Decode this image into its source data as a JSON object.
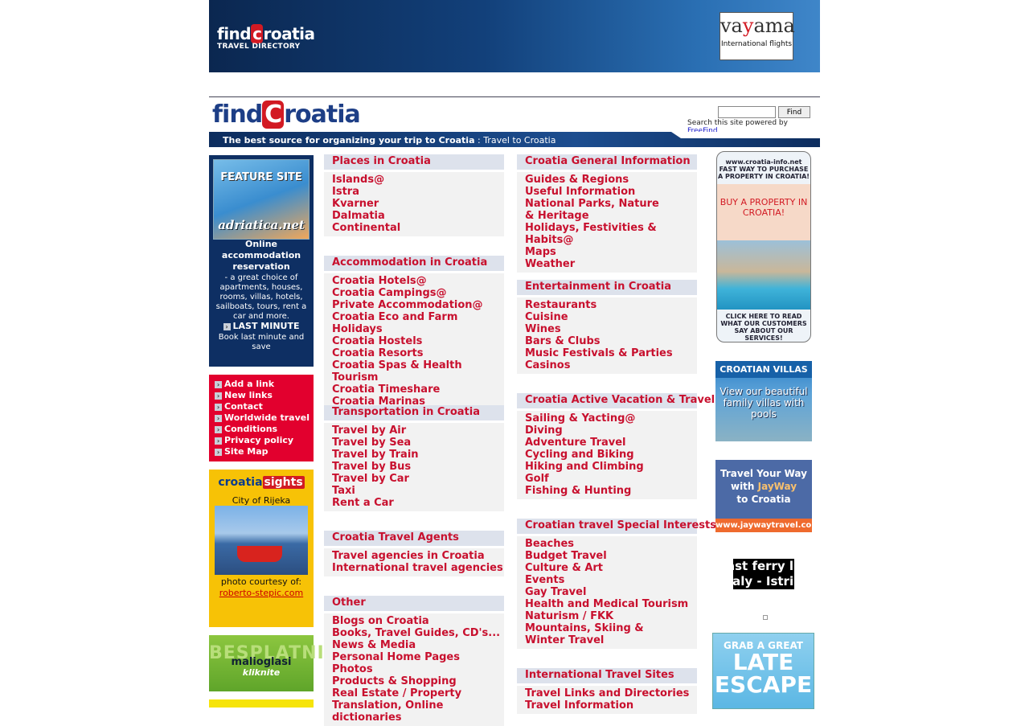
{
  "banner": {
    "logo_line1": "findcroatia",
    "logo_line2": "TRAVEL DIRECTORY",
    "ad_vayama": {
      "name": "vayama",
      "tagline": "International flights"
    }
  },
  "header": {
    "logo": "findcroatia",
    "search": {
      "placeholder": "",
      "button": "Find",
      "powered_text": "Search this site powered by",
      "powered_link": "FreeFind"
    },
    "tagline_bold": "The best source for organizing your trip to Croatia",
    "tagline_rest": " : Travel to Croatia"
  },
  "sidebar": {
    "feature": {
      "badge": "FEATURE SITE",
      "site": "adriatica.net",
      "title": "Online accommodation reservation",
      "desc": "- a great choice of apartments, houses, rooms, villas, hotels, sailboats, tours, rent a car and more.",
      "last_minute": "LAST MINUTE",
      "last_minute_desc": "Book last minute and save"
    },
    "links": [
      "Add a link",
      "New links",
      "Contact",
      "Worldwide travel",
      "Conditions",
      "Privacy policy",
      "Site Map"
    ],
    "sights": {
      "logo_a": "croatia",
      "logo_b": "sights",
      "city": "City of Rijeka",
      "caption": "photo courtesy of:",
      "credit": "roberto-stepic.com"
    },
    "oglasi": {
      "big": "BESPLATNI",
      "name": "malioglasi",
      "cta": "kliknite"
    }
  },
  "columns": {
    "left": [
      {
        "title": "Places in Croatia",
        "links": [
          "Islands@",
          "Istra",
          "Kvarner",
          "Dalmatia",
          "Continental"
        ]
      },
      {
        "title": "Accommodation in Croatia",
        "links": [
          "Croatia Hotels@",
          "Croatia Campings@",
          "Private Accommodation@",
          "Croatia Eco and Farm Holidays",
          "Croatia Hostels",
          "Croatia Resorts",
          "Croatia Spas & Health Tourism",
          "Croatia Timeshare",
          "Croatia Marinas"
        ]
      },
      {
        "title": "Transportation in Croatia",
        "links": [
          "Travel by Air",
          "Travel by Sea",
          "Travel by Train",
          "Travel by Bus",
          "Travel by Car",
          "Taxi",
          "Rent a Car"
        ]
      },
      {
        "title": "Croatia Travel Agents",
        "links": [
          "Travel agencies in Croatia",
          "International travel agencies"
        ]
      },
      {
        "title": "Other",
        "links": [
          "Blogs on Croatia",
          "Books, Travel Guides, CD's...",
          "News & Media",
          "Personal Home Pages",
          "Photos",
          "Products & Shopping",
          "Real Estate / Property",
          "Translation, Online dictionaries"
        ]
      }
    ],
    "right": [
      {
        "title": "Croatia General Information",
        "links": [
          "Guides & Regions",
          "Useful Information",
          "National Parks, Nature & Heritage",
          "Holidays, Festivities & Habits@",
          "Maps",
          "Weather"
        ]
      },
      {
        "title": "Entertainment in Croatia",
        "links": [
          "Restaurants",
          "Cuisine",
          "Wines",
          "Bars & Clubs",
          "Music Festivals & Parties",
          "Casinos"
        ]
      },
      {
        "title": "Croatia Active Vacation & Travel",
        "links": [
          "Sailing & Yacting@",
          "Diving",
          "Adventure Travel",
          "Cycling and Biking",
          "Hiking and Climbing",
          "Golf",
          "Fishing & Hunting"
        ]
      },
      {
        "title": "Croatian travel Special Interests",
        "links": [
          "Beaches",
          "Budget Travel",
          "Culture & Art",
          "Events",
          "Gay Travel",
          "Health and Medical Tourism",
          "Naturism / FKK",
          "Mountains, Skiing & Winter Travel"
        ]
      },
      {
        "title": "International Travel Sites",
        "links": [
          "Travel Links and Directories",
          "Travel Information"
        ]
      }
    ]
  },
  "ads": {
    "croatia_info": {
      "top": "www.croatia-info.net FAST WAY TO PURCHASE A PROPERTY IN CROATIA!",
      "mid": "BUY A PROPERTY IN CROATIA!",
      "bottom": "CLICK HERE TO READ WHAT OUR CUSTOMERS SAY ABOUT OUR SERVICES!"
    },
    "villas": {
      "title": "CROATIAN VILLAS",
      "text": "View our beautiful family villas with pools"
    },
    "jayway": {
      "line1": "Travel Your Way",
      "line2a": "with ",
      "line2b": "JayWay",
      "line3": "to Croatia",
      "url": "www.jaywaytravel.com"
    },
    "ferry": {
      "line1": "ast ferry lin",
      "line2": "taly - Istri"
    },
    "late": {
      "line1": "GRAB A GREAT",
      "line2": "LATE",
      "line3": "ESCAPE"
    }
  },
  "colors": {
    "accent_red": "#c8102e",
    "navy": "#0e2f63",
    "category_header": "#dde2ec"
  }
}
